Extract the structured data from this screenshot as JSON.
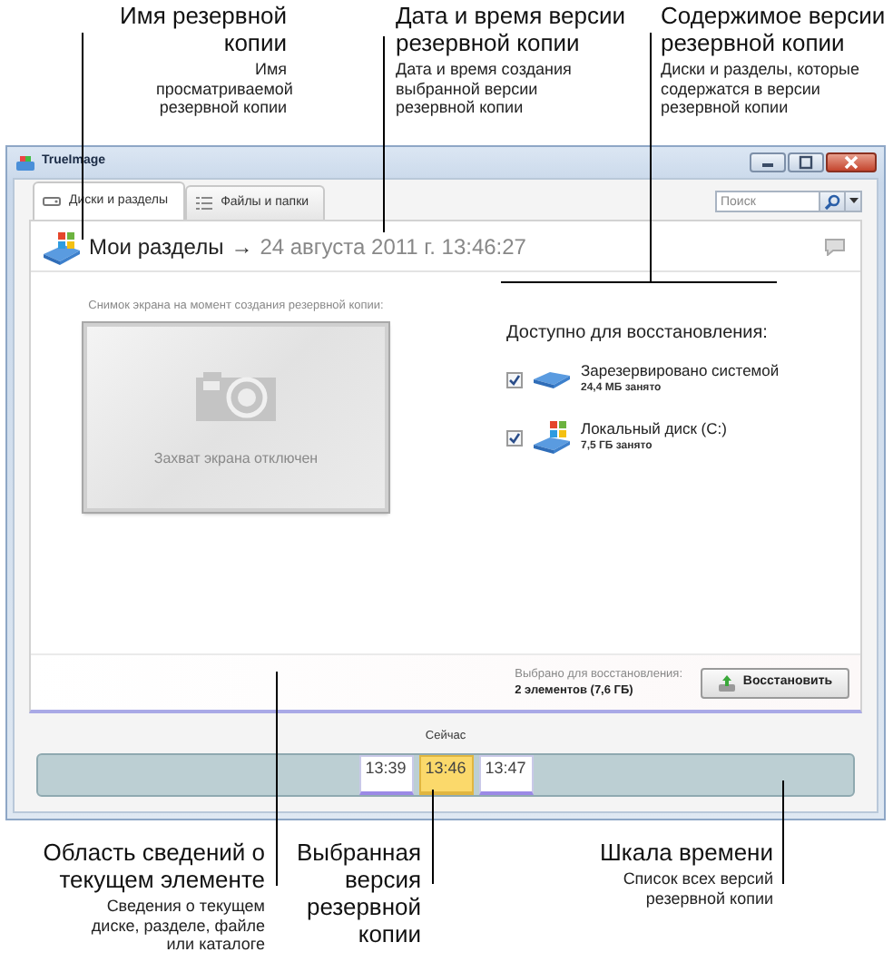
{
  "top_callouts": [
    {
      "title": "Имя резервной копии",
      "description": "Имя просматриваемой резервной копии"
    },
    {
      "title": "Дата и время версии резервной копии",
      "description": "Дата и время создания выбранной версии резервной копии"
    },
    {
      "title": "Содержимое версии резервной копии",
      "description": "Диски и разделы, которые содержатся в версии резервной копии"
    }
  ],
  "window": {
    "title": "TrueImage",
    "tabs": [
      {
        "label": "Диски и разделы",
        "selected": true,
        "kind": "disks"
      },
      {
        "label": "Файлы и папки",
        "selected": false,
        "kind": "files"
      }
    ],
    "search": {
      "placeholder": "Поиск"
    },
    "backup": {
      "name": "Мои разделы",
      "arrow": "→",
      "date": "24 августа 2011 г. 13:46:27"
    },
    "screenshot": {
      "caption": "Снимок экрана на момент создания резервной копии:",
      "message": "Захват экрана отключен"
    },
    "restore": {
      "heading": "Доступно для восстановления:",
      "items": [
        {
          "name": "Зарезервировано системой",
          "size": "24,4 МБ занято",
          "checked": true,
          "kind": "system"
        },
        {
          "name": "Локальный диск (C:)",
          "size": "7,5 ГБ занято",
          "checked": true,
          "kind": "windows"
        }
      ]
    },
    "footer": {
      "label": "Выбрано для восстановления:",
      "value": "2 элементов (7,6 ГБ)",
      "button": "Восстановить"
    },
    "timeline": {
      "now_label": "Сейчас",
      "versions": [
        {
          "time": "13:39",
          "selected": false
        },
        {
          "time": "13:46",
          "selected": true
        },
        {
          "time": "13:47",
          "selected": false
        }
      ]
    }
  },
  "bottom_callouts": [
    {
      "title": "Область сведений о текущем элементе",
      "description": "Сведения о текущем диске, разделе, файле или каталоге"
    },
    {
      "title": "Выбранная версия резервной копии"
    },
    {
      "title": "Шкала времени",
      "description": "Список всех версий резервной копии"
    }
  ]
}
